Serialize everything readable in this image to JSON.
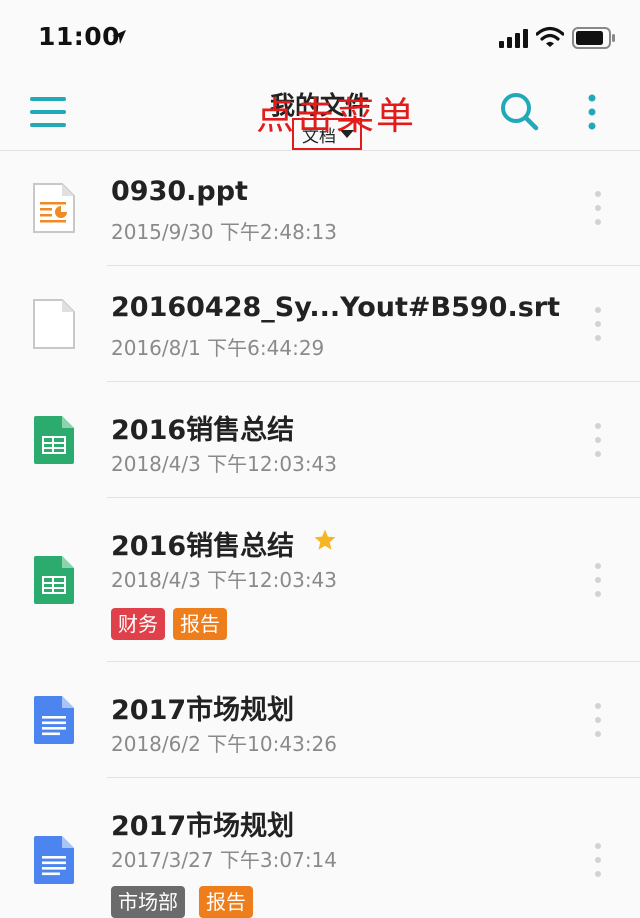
{
  "status_bar": {
    "time": "11:00",
    "icons": [
      "location-arrow-icon",
      "cellular-signal-icon",
      "wifi-icon",
      "battery-icon"
    ]
  },
  "header": {
    "title": "我的文件",
    "filter_label": "文档",
    "menu_icon": "hamburger-menu-icon",
    "search_icon": "search-icon",
    "more_icon": "more-vertical-icon",
    "accent_color": "#22a9b8"
  },
  "annotation": {
    "text": "点击菜单",
    "color": "#e21b1b"
  },
  "files": [
    {
      "name": "0930.ppt",
      "date": "2015/9/30 下午2:48:13",
      "icon": "presentation-file-icon",
      "starred": false,
      "tags": []
    },
    {
      "name": "20160428_Sy...Yout#B590.srt",
      "date": "2016/8/1 下午6:44:29",
      "icon": "generic-file-icon",
      "starred": false,
      "tags": []
    },
    {
      "name": "2016销售总结",
      "date": "2018/4/3 下午12:03:43",
      "icon": "spreadsheet-file-icon",
      "starred": false,
      "tags": []
    },
    {
      "name": "2016销售总结",
      "date": "2018/4/3 下午12:03:43",
      "icon": "spreadsheet-file-icon",
      "starred": true,
      "tags": [
        {
          "label": "财务",
          "color": "#e0404a"
        },
        {
          "label": "报告",
          "color": "#ee7d1b"
        }
      ]
    },
    {
      "name": "2017市场规划",
      "date": "2018/6/2 下午10:43:26",
      "icon": "document-file-icon",
      "starred": false,
      "tags": []
    },
    {
      "name": "2017市场规划",
      "date": "2017/3/27 下午3:07:14",
      "icon": "document-file-icon",
      "starred": false,
      "tags": [
        {
          "label": "市场部",
          "color": "#6b6b6b"
        },
        {
          "label": "报告",
          "color": "#ee7d1b"
        }
      ]
    }
  ]
}
